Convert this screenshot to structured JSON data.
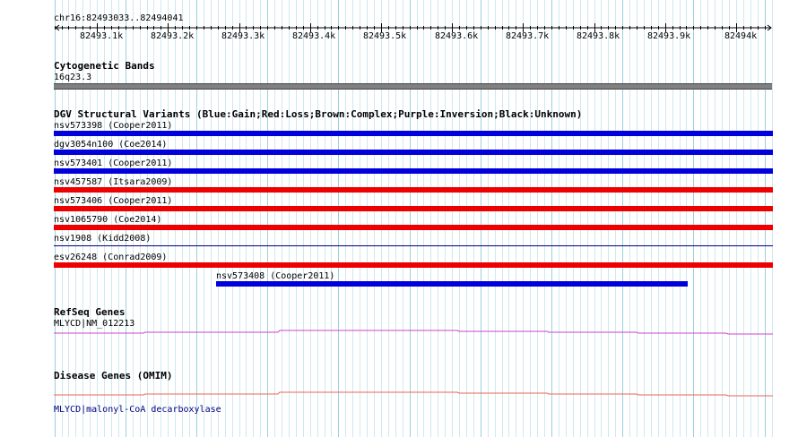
{
  "ruler": {
    "coords": "chr16:82493033..82494041",
    "ticks": [
      "82493.1k",
      "82493.2k",
      "82493.3k",
      "82493.4k",
      "82493.5k",
      "82493.6k",
      "82493.7k",
      "82493.8k",
      "82493.9k",
      "82494k"
    ]
  },
  "cytoband": {
    "title": "Cytogenetic Bands",
    "band": "16q23.3"
  },
  "dgv": {
    "title": "DGV Structural Variants (Blue:Gain;Red:Loss;Brown:Complex;Purple:Inversion;Black:Unknown)",
    "items": [
      {
        "label": "nsv573398 (Cooper2011)",
        "color": "#0000dd"
      },
      {
        "label": "dgv3054n100 (Coe2014)",
        "color": "#0000dd"
      },
      {
        "label": "nsv573401 (Cooper2011)",
        "color": "#0000dd"
      },
      {
        "label": "nsv457587 (Itsara2009)",
        "color": "#ee0000"
      },
      {
        "label": "nsv573406 (Cooper2011)",
        "color": "#ee0000"
      },
      {
        "label": "nsv1065790 (Coe2014)",
        "color": "#ee0000"
      },
      {
        "label": "nsv1908 (Kidd2008)",
        "color": "#000080"
      },
      {
        "label": "esv26248 (Conrad2009)",
        "color": "#ee0000"
      },
      {
        "label": "nsv573408 (Cooper2011)",
        "color": "#0000dd"
      }
    ]
  },
  "refseq": {
    "title": "RefSeq Genes",
    "gene": "MLYCD|NM_012213",
    "color": "#cc44cc"
  },
  "disease": {
    "title": "Disease Genes (OMIM)",
    "gene": "MLYCD|malonyl-CoA decarboxylase",
    "color": "#ee6655"
  }
}
